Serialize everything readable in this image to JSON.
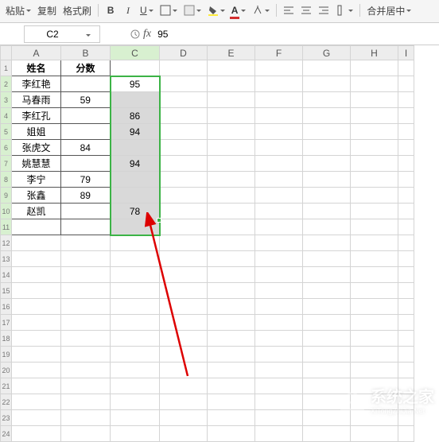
{
  "toolbar": {
    "paste_label": "粘贴",
    "copy_label": "复制",
    "format_painter_label": "格式刷",
    "merge_center_label": "合并居中",
    "bold": "B",
    "italic": "I",
    "underline": "U"
  },
  "namebox": {
    "value": "C2"
  },
  "formula_bar": {
    "insert_fn_icon": "fx",
    "value": "95"
  },
  "columns": [
    "A",
    "B",
    "C",
    "D",
    "E",
    "F",
    "G",
    "H",
    "I"
  ],
  "headers": {
    "A": "姓名",
    "B": "分数"
  },
  "rows": [
    {
      "name": "李红艳",
      "score": "",
      "c": "95"
    },
    {
      "name": "马春雨",
      "score": "59",
      "c": ""
    },
    {
      "name": "李红孔",
      "score": "",
      "c": "86"
    },
    {
      "name": "姐姐",
      "score": "",
      "c": "94"
    },
    {
      "name": "张虎文",
      "score": "84",
      "c": ""
    },
    {
      "name": "姚慧慧",
      "score": "",
      "c": "94"
    },
    {
      "name": "李宁",
      "score": "79",
      "c": ""
    },
    {
      "name": "张鑫",
      "score": "89",
      "c": ""
    },
    {
      "name": "赵凯",
      "score": "",
      "c": "78"
    }
  ],
  "selection": {
    "range": "C2:C11",
    "active": "C2"
  },
  "watermark": {
    "text": "系统之家",
    "sub": "XiTongZhiJia.Net"
  }
}
